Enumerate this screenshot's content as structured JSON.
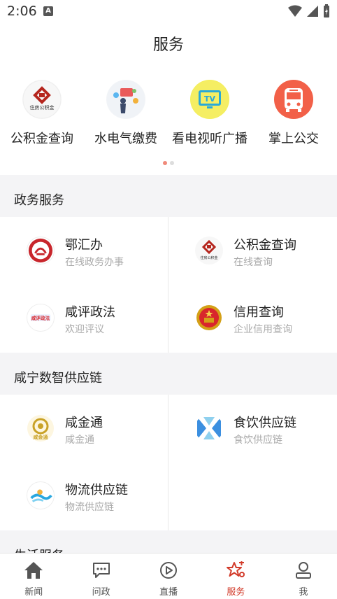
{
  "status": {
    "time": "2:06",
    "app_badge": "A"
  },
  "header": {
    "title": "服务"
  },
  "quick_services": [
    {
      "label": "公积金查询",
      "icon": "housing-fund-icon"
    },
    {
      "label": "水电气缴费",
      "icon": "utility-bill-icon"
    },
    {
      "label": "看电视听广播",
      "icon": "tv-icon"
    },
    {
      "label": "掌上公交",
      "icon": "bus-icon"
    }
  ],
  "carousel": {
    "page": 1,
    "pages": 2
  },
  "sections": [
    {
      "title": "政务服务",
      "items": [
        {
          "title": "鄂汇办",
          "subtitle": "在线政务办事",
          "icon": "ehuiban-logo-icon"
        },
        {
          "title": "公积金查询",
          "subtitle": "在线查询",
          "icon": "housing-fund-logo-icon"
        },
        {
          "title": "咸评政法",
          "subtitle": "欢迎评议",
          "icon": "xianping-logo-icon"
        },
        {
          "title": "信用查询",
          "subtitle": "企业信用查询",
          "icon": "national-emblem-icon"
        }
      ]
    },
    {
      "title": "咸宁数智供应链",
      "items": [
        {
          "title": "咸金通",
          "subtitle": "咸金通",
          "icon": "xianjintong-logo-icon"
        },
        {
          "title": "食饮供应链",
          "subtitle": "食饮供应链",
          "icon": "food-supply-logo-icon"
        },
        {
          "title": "物流供应链",
          "subtitle": "物流供应链",
          "icon": "logistics-logo-icon"
        }
      ]
    },
    {
      "title": "生活服务"
    }
  ],
  "logo_text": {
    "housing_fund": "住房公积金",
    "xianping": "咸评政法",
    "xianjintong": "咸金通",
    "tv": "TV"
  },
  "bottom_nav": [
    {
      "label": "新闻",
      "icon": "home-icon",
      "active": false
    },
    {
      "label": "问政",
      "icon": "chat-icon",
      "active": false
    },
    {
      "label": "直播",
      "icon": "play-icon",
      "active": false
    },
    {
      "label": "服务",
      "icon": "service-star-icon",
      "active": true
    },
    {
      "label": "我",
      "icon": "user-icon",
      "active": false
    }
  ],
  "colors": {
    "accent": "#d23b2a",
    "section_bg": "#f4f4f6",
    "subtitle": "#aaaaaa"
  }
}
